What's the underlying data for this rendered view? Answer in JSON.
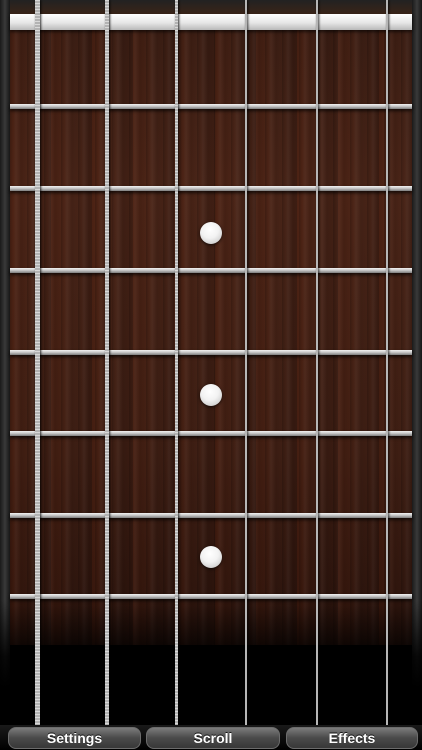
{
  "app": {
    "view": "guitar-fretboard"
  },
  "fretboard": {
    "strings": 6,
    "frets_visible": 7,
    "inlay_frets": [
      3,
      5,
      7
    ]
  },
  "toolbar": {
    "settings_label": "Settings",
    "scroll_label": "Scroll",
    "effects_label": "Effects"
  }
}
